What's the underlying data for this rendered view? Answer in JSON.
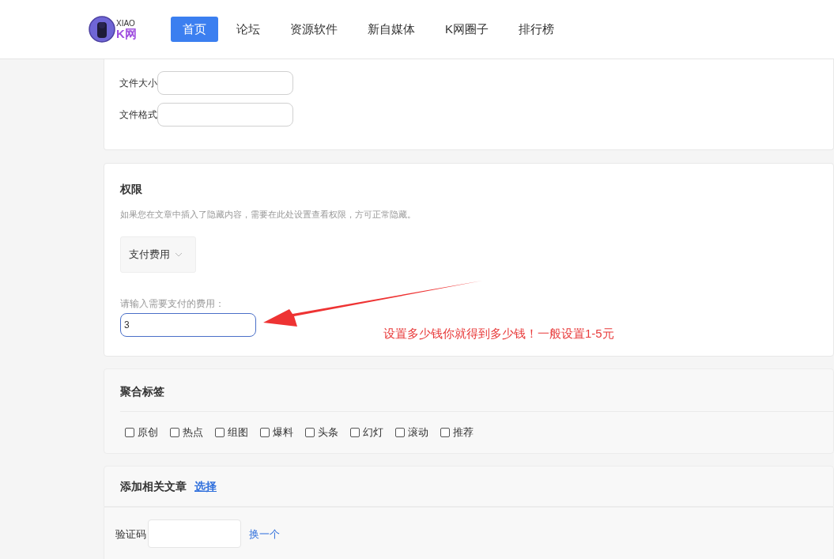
{
  "header": {
    "logo": {
      "small": "XIAO",
      "main": "K网"
    },
    "nav": [
      {
        "label": "首页",
        "selected": true
      },
      {
        "label": "论坛",
        "selected": false
      },
      {
        "label": "资源软件",
        "selected": false
      },
      {
        "label": "新自媒体",
        "selected": false
      },
      {
        "label": "K网圈子",
        "selected": false
      },
      {
        "label": "排行榜",
        "selected": false
      }
    ]
  },
  "file_fields": [
    {
      "label": "文件大小"
    },
    {
      "label": "文件格式"
    }
  ],
  "permission": {
    "title": "权限",
    "description": "如果您在文章中插入了隐藏内容，需要在此处设置查看权限，方可正常隐藏。",
    "select": "支付费用",
    "fee_label": "请输入需要支付的费用：",
    "fee_value": "3",
    "annotation": "设置多少钱你就得到多少钱！一般设置1-5元"
  },
  "tags": {
    "title": "聚合标签",
    "items": [
      {
        "label": "原创",
        "checked": false
      },
      {
        "label": "热点",
        "checked": false
      },
      {
        "label": "组图",
        "checked": false
      },
      {
        "label": "爆料",
        "checked": false
      },
      {
        "label": "头条",
        "checked": false
      },
      {
        "label": "幻灯",
        "checked": false
      },
      {
        "label": "滚动",
        "checked": false
      },
      {
        "label": "推荐",
        "checked": false
      }
    ]
  },
  "related": {
    "title": "添加相关文章",
    "link": "选择"
  },
  "captcha": {
    "label": "验证码",
    "link": "换一个"
  }
}
